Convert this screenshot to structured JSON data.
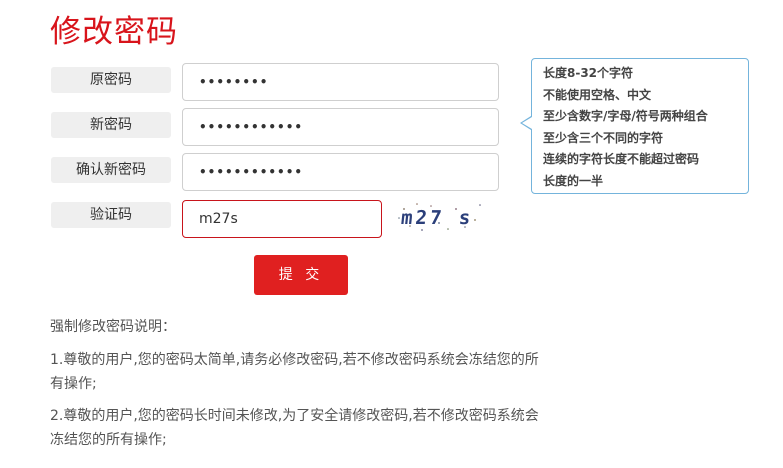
{
  "page": {
    "title": "修改密码"
  },
  "form": {
    "old_password": {
      "label": "原密码",
      "value": "••••••••"
    },
    "new_password": {
      "label": "新密码",
      "value": "••••••••••••"
    },
    "confirm_password": {
      "label": "确认新密码",
      "value": "••••••••••••"
    },
    "captcha": {
      "label": "验证码",
      "value": "m27s",
      "image_text": "m27 s"
    },
    "submit_label": "提 交"
  },
  "tip": {
    "lines": [
      "长度8-32个字符",
      "不能使用空格、中文",
      "至少含数字/字母/符号两种组合",
      "至少含三个不同的字符",
      "连续的字符长度不能超过密码",
      "长度的一半"
    ],
    "border_color": "#74b4dc"
  },
  "notes": {
    "heading": "强制修改密码说明：",
    "items": [
      "1.尊敬的用户,您的密码太简单,请务必修改密码,若不修改密码系统会冻结您的所有操作;",
      "2.尊敬的用户,您的密码长时间未修改,为了安全请修改密码,若不修改密码系统会冻结您的所有操作;"
    ]
  },
  "colors": {
    "accent": "#d8141b",
    "button": "#e02020",
    "label_bg": "#efefef"
  }
}
